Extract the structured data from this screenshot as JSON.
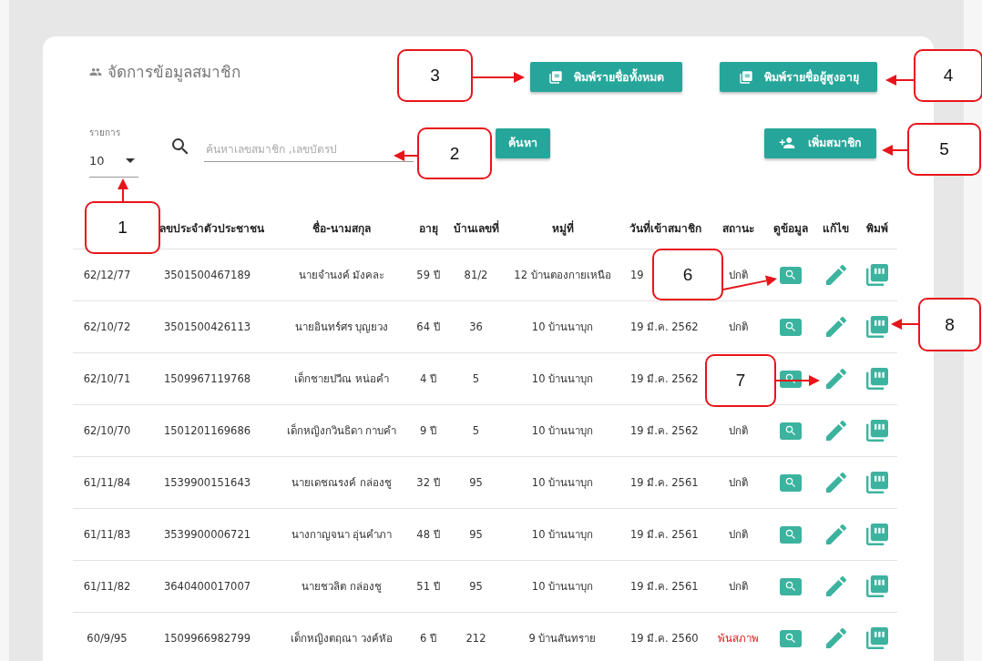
{
  "title": "จัดการข้อมูลสมาชิก",
  "print_buttons": [
    "พิมพ์รายชื่อทั้งหมด",
    "พิมพ์รายชื่อผู้สูงอายุ"
  ],
  "page_size": {
    "label": "รายการ",
    "value": "10"
  },
  "search": {
    "placeholder": "ค้นหาเลขสมาชิก ,เลขบัตรป",
    "button": "ค้นหา"
  },
  "add_button": "เพิ่มสมาชิก",
  "table": {
    "columns": [
      "ลขประจำตัวประชาชน",
      "ชื่อ-นามสกุล",
      "อายุ",
      "บ้านเลขที่",
      "หมู่ที่",
      "วันที่เข้าสมาชิก",
      "สถานะ",
      "ดูข้อมูล",
      "แก้ไข",
      "พิมพ์"
    ],
    "rows": [
      {
        "member_no": "62/12/77",
        "citizen_id": "3501500467189",
        "name": "นายจำนงค์ มังคละ",
        "age": "59 ปี",
        "house_no": "81/2",
        "village": "12 บ้านตองกายเหนือ",
        "joined": "19",
        "status": "ปกติ",
        "alert": false
      },
      {
        "member_no": "62/10/72",
        "citizen_id": "3501500426113",
        "name": "นายอินทร์ศร บุญยวง",
        "age": "64 ปี",
        "house_no": "36",
        "village": "10 บ้านนาบุก",
        "joined": "19 มี.ค. 2562",
        "status": "ปกติ",
        "alert": false
      },
      {
        "member_no": "62/10/71",
        "citizen_id": "1509967119768",
        "name": "เด็กชายปวีณ หน่อคำ",
        "age": "4 ปี",
        "house_no": "5",
        "village": "10 บ้านนาบุก",
        "joined": "19 มี.ค. 2562"
      },
      {
        "member_no": "62/10/70",
        "citizen_id": "1501201169686",
        "name": "เด็กหญิงกวินธิดา กาบคำ",
        "age": "9 ปี",
        "house_no": "5",
        "village": "10 บ้านนาบุก",
        "joined": "19 มี.ค. 2562",
        "status": "ปกติ",
        "alert": false
      },
      {
        "member_no": "61/11/84",
        "citizen_id": "1539900151643",
        "name": "นายเดชณรงค์ กล่องชู",
        "age": "32 ปี",
        "house_no": "95",
        "village": "10 บ้านนาบุก",
        "joined": "19 มี.ค. 2561",
        "status": "ปกติ",
        "alert": false
      },
      {
        "member_no": "61/11/83",
        "citizen_id": "3539900006721",
        "name": "นางกาญจนา อุ่นคำภา",
        "age": "48 ปี",
        "house_no": "95",
        "village": "10 บ้านนาบุก",
        "joined": "19 มี.ค. 2561",
        "status": "ปกติ",
        "alert": false
      },
      {
        "member_no": "61/11/82",
        "citizen_id": "3640400017007",
        "name": "นายชวลิต กล่องชู",
        "age": "51 ปี",
        "house_no": "95",
        "village": "10 บ้านนาบุก",
        "joined": "19 มี.ค. 2561",
        "status": "ปกติ",
        "alert": false
      },
      {
        "member_no": "60/9/95",
        "citizen_id": "1509966982799",
        "name": "เด็กหญิงตฤณา วงค์หัอ",
        "age": "6 ปี",
        "house_no": "212",
        "village": "9 บ้านสันทราย",
        "joined": "19 มี.ค. 2560",
        "status": "พ้นสภาพ",
        "alert": true
      }
    ]
  },
  "callouts": [
    {
      "number": "1"
    },
    {
      "number": "2"
    },
    {
      "number": "3"
    },
    {
      "number": "4"
    },
    {
      "number": "5"
    },
    {
      "number": "6"
    },
    {
      "number": "7"
    },
    {
      "number": "8"
    }
  ]
}
